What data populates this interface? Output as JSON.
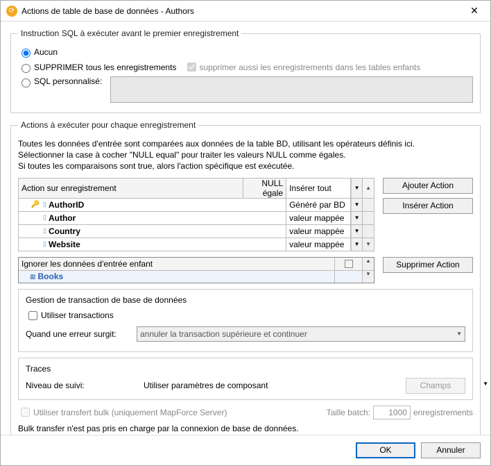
{
  "titlebar": {
    "title": "Actions de table de base de données - Authors"
  },
  "sql_section": {
    "legend": "Instruction SQL à exécuter avant le premier enregistrement",
    "opt_none": "Aucun",
    "opt_delete": "SUPPRIMER tous les enregistrements",
    "opt_delete_sub": "supprimer aussi les enregistrements dans les tables enfants",
    "opt_custom": "SQL personnalisé:"
  },
  "actions_section": {
    "legend": "Actions à exécuter pour chaque enregistrement",
    "desc1": "Toutes les données d'entrée sont comparées aux données de la table BD, utilisant les opérateurs définis ici.",
    "desc2": "Sélectionner la case à cocher \"NULL equal\" pour traiter les valeurs NULL comme égales.",
    "desc3": "Si toutes les comparaisons sont true, alors l'action spécifique est exécutée.",
    "header_action": "Action sur enregistrement",
    "header_null": "NULL égale",
    "header_value": "Insérer tout",
    "columns": [
      {
        "name": "AuthorID",
        "pk": true,
        "value": "Généré par BD"
      },
      {
        "name": "Author",
        "pk": false,
        "value": "valeur mappée"
      },
      {
        "name": "Country",
        "pk": false,
        "value": "valeur mappée"
      },
      {
        "name": "Website",
        "pk": false,
        "value": "valeur mappée"
      }
    ],
    "btn_add": "Ajouter Action",
    "btn_insert": "Insérer Action",
    "child_header": "Ignorer les données d'entrée enfant",
    "child_row": "Books",
    "btn_delete": "Supprimer Action"
  },
  "trans_section": {
    "title": "Gestion de transaction de base de données",
    "use_trans": "Utiliser transactions",
    "on_error": "Quand une erreur surgit:",
    "on_error_value": "annuler la transaction supérieure et continuer"
  },
  "traces_section": {
    "title": "Traces",
    "level": "Niveau de suivi:",
    "level_value": "Utiliser paramètres de composant",
    "btn_fields": "Champs"
  },
  "bulk": {
    "label": "Utiliser transfert bulk (uniquement MapForce Server)",
    "batch_label": "Taille batch:",
    "batch_value": "1000",
    "batch_unit": "enregistrements",
    "note": "Bulk transfer n'est pas pris en charge par la connexion de base de données."
  },
  "footer": {
    "ok": "OK",
    "cancel": "Annuler"
  }
}
